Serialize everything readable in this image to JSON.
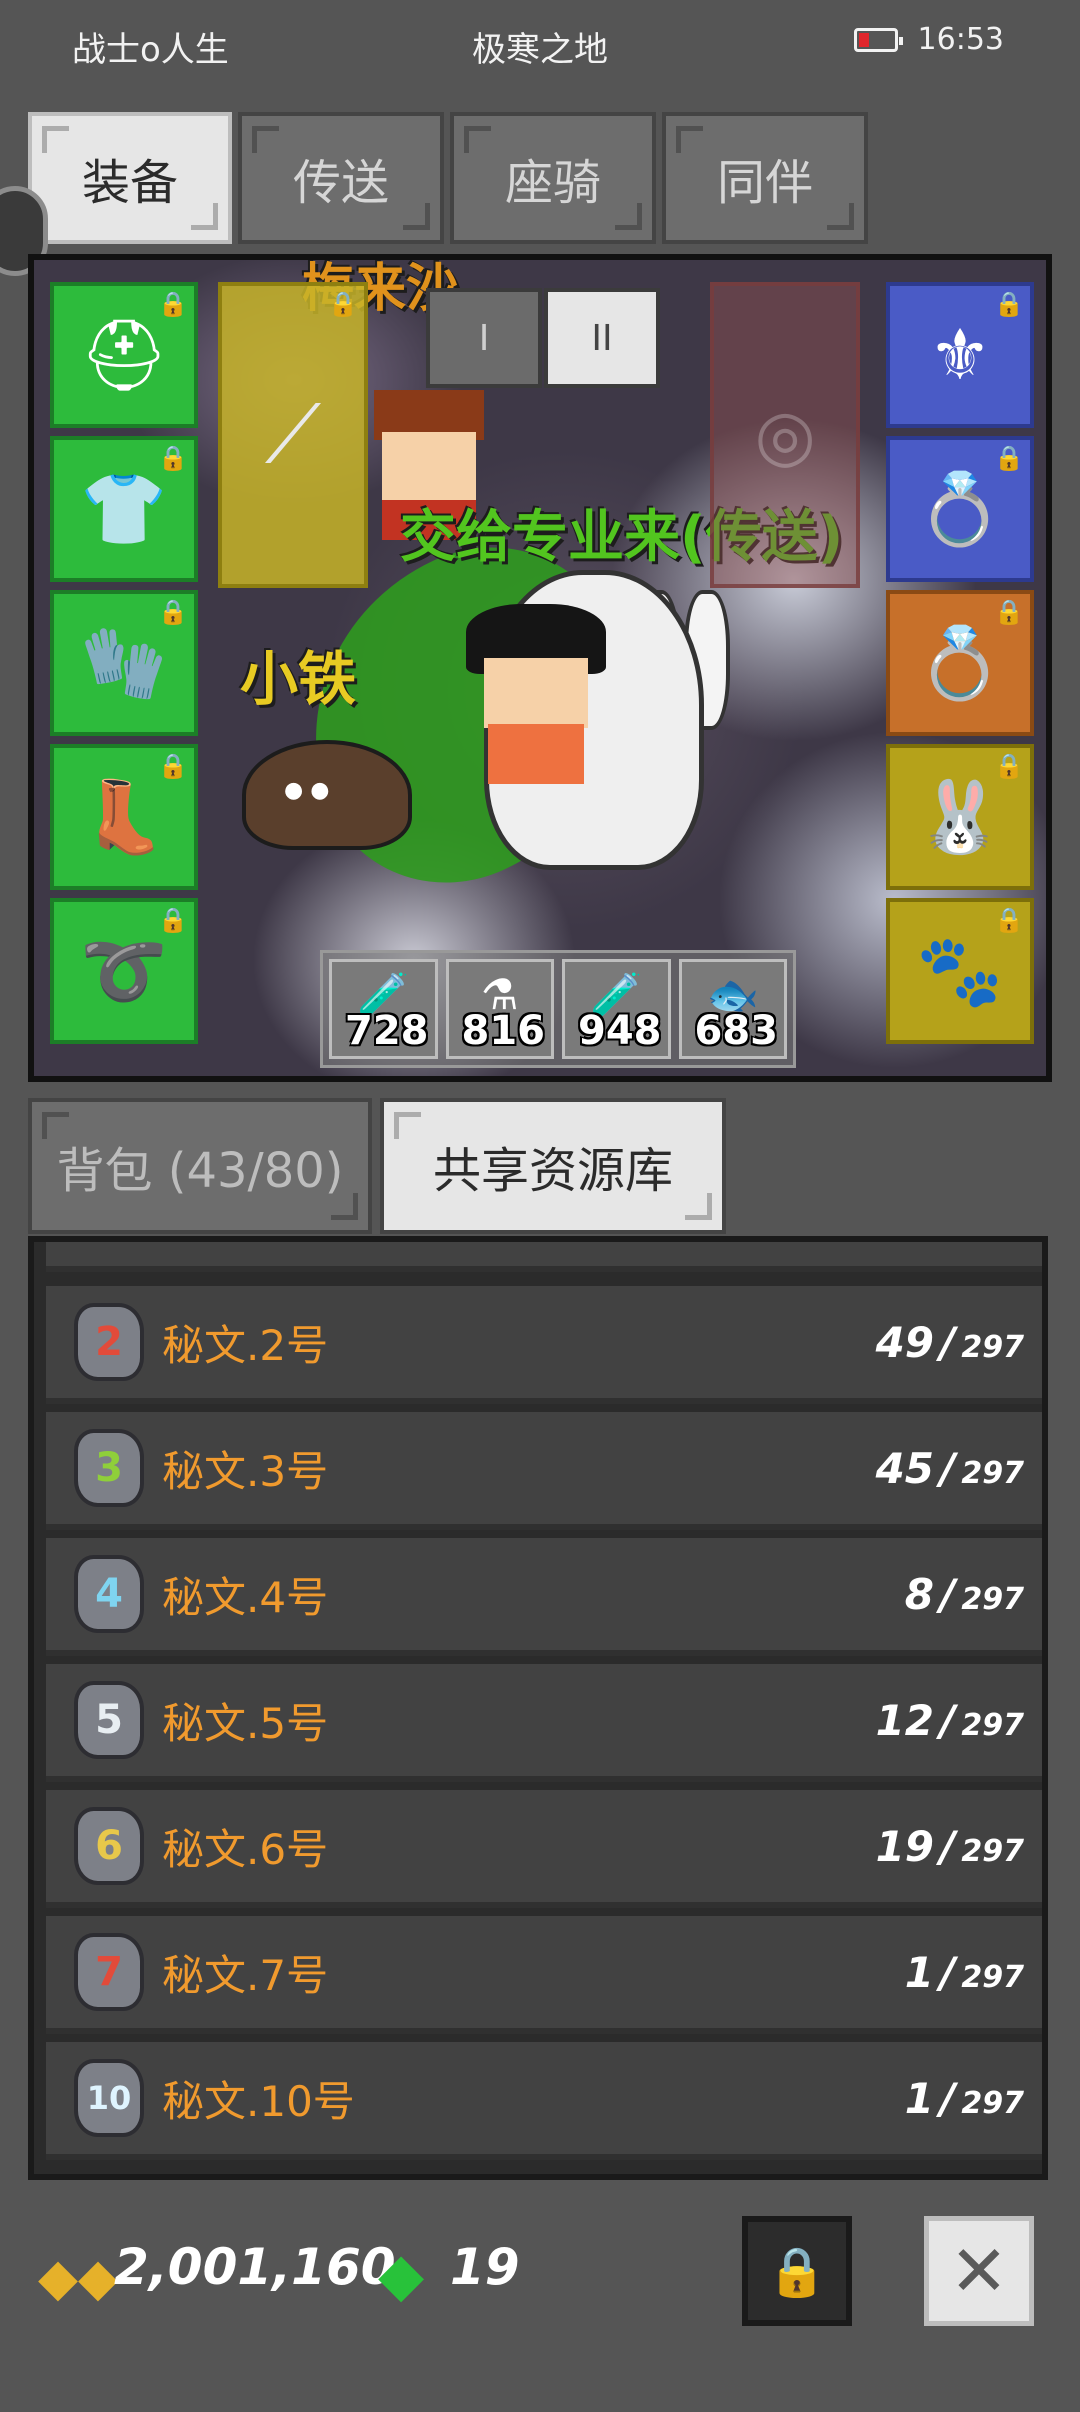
{
  "status_bar": {
    "player": "战士o人生",
    "location": "极寒之地",
    "time": "16:53"
  },
  "top_tabs": [
    {
      "label": "装备",
      "active": true
    },
    {
      "label": "传送",
      "active": false
    },
    {
      "label": "座骑",
      "active": false
    },
    {
      "label": "同伴",
      "active": false
    }
  ],
  "scene": {
    "top_name_partial": "梅来沙",
    "guild_label": "交给专业来(传送)",
    "companion_label": "小铁",
    "mode_buttons": [
      "I",
      "II"
    ],
    "left_slots": [
      {
        "icon": "helmet-icon",
        "glyph": "⛑"
      },
      {
        "icon": "armor-icon",
        "glyph": "👕"
      },
      {
        "icon": "gauntlet-icon",
        "glyph": "🧤"
      },
      {
        "icon": "boots-icon",
        "glyph": "👢"
      },
      {
        "icon": "belt-icon",
        "glyph": "➰"
      }
    ],
    "right_slots": [
      {
        "icon": "amulet-icon",
        "glyph": "⚜",
        "color": "blue"
      },
      {
        "icon": "ring-icon",
        "glyph": "💍",
        "color": "blue"
      },
      {
        "icon": "ruby-ring-icon",
        "glyph": "💍",
        "color": "orange"
      },
      {
        "icon": "rabbit-ears-icon",
        "glyph": "🐰",
        "color": "yellow"
      },
      {
        "icon": "pet-icon",
        "glyph": "🐾",
        "color": "yellow"
      }
    ],
    "consumables": [
      {
        "icon": "red-potion-icon",
        "glyph": "🧪",
        "count": "728"
      },
      {
        "icon": "white-potion-icon",
        "glyph": "⚗",
        "count": "816"
      },
      {
        "icon": "blue-potion-icon",
        "glyph": "🧪",
        "count": "948"
      },
      {
        "icon": "fish-icon",
        "glyph": "🐟",
        "count": "683"
      }
    ]
  },
  "bottom_tabs": [
    {
      "label": "背包 (43/80)",
      "active": false
    },
    {
      "label": "共享资源库",
      "active": true
    }
  ],
  "items": [
    {
      "name": "秘文.2号",
      "digit": "2",
      "digit_color": "#e24b3a",
      "count": "49",
      "max": "297"
    },
    {
      "name": "秘文.3号",
      "digit": "3",
      "digit_color": "#8fcf3a",
      "count": "45",
      "max": "297"
    },
    {
      "name": "秘文.4号",
      "digit": "4",
      "digit_color": "#7fd4f0",
      "count": "8",
      "max": "297"
    },
    {
      "name": "秘文.5号",
      "digit": "5",
      "digit_color": "#e8eef2",
      "count": "12",
      "max": "297"
    },
    {
      "name": "秘文.6号",
      "digit": "6",
      "digit_color": "#e8c84a",
      "count": "19",
      "max": "297"
    },
    {
      "name": "秘文.7号",
      "digit": "7",
      "digit_color": "#e24b3a",
      "count": "1",
      "max": "297"
    },
    {
      "name": "秘文.10号",
      "digit": "10",
      "digit_color": "#dff4ff",
      "count": "1",
      "max": "297"
    }
  ],
  "footer": {
    "gold": "2,001,160",
    "gems": "19"
  }
}
